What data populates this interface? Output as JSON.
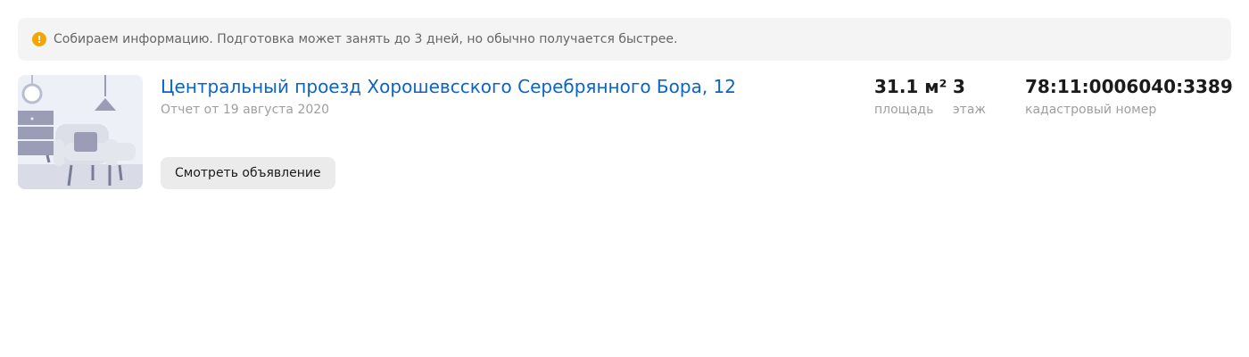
{
  "notice": {
    "icon": "exclamation-icon",
    "icon_glyph": "!",
    "icon_color": "#f7a300",
    "text": "Собираем информацию. Подготовка может занять до 3 дней, но обычно получается быстрее."
  },
  "report": {
    "thumbnail_icon": "room-illustration-icon",
    "address": "Центральный проезд Хорошевсского Серебрянного Бора, 12",
    "date": "Отчет от 19 августа 2020",
    "view_button_label": "Смотреть объявление",
    "stats": {
      "area": {
        "value": "31.1 м²",
        "label": "площадь"
      },
      "floor": {
        "value": "3",
        "label": "этаж"
      },
      "cadastral": {
        "value": "78:11:0006040:3389",
        "label": "кадастровый номер"
      }
    }
  },
  "colors": {
    "link": "#0a64c9",
    "notice_background": "#f4f4f4",
    "button_background": "#ebebeb",
    "muted_text": "#9e9e9e"
  }
}
